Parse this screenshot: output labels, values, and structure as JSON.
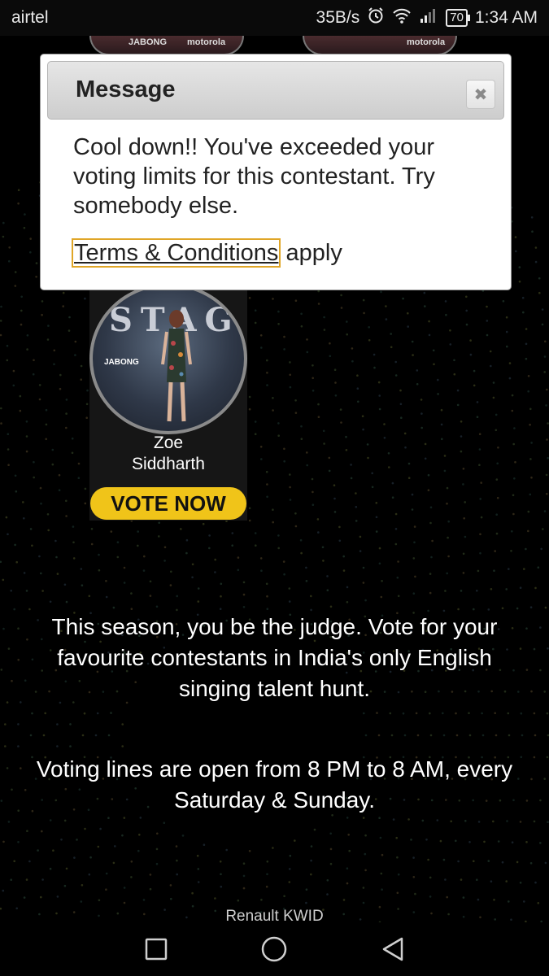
{
  "status_bar": {
    "carrier": "airtel",
    "speed": "35B/s",
    "battery": "70",
    "time": "1:34 AM"
  },
  "peek_cards": {
    "left_brand": "JABONG",
    "left_sponsor": "motorola",
    "right_sponsor": "motorola"
  },
  "modal": {
    "title": "Message",
    "message": "Cool down!! You've exceeded your voting limits for this contestant. Try somebody else.",
    "terms_link": "Terms & Conditions",
    "terms_suffix": " apply"
  },
  "contestant": {
    "photo_text": "STAGE",
    "photo_brand": "JABONG",
    "name_line1": "Zoe",
    "name_line2": "Siddharth",
    "vote_label": "VOTE NOW"
  },
  "description": {
    "paragraph1": "This season, you be the judge. Vote for your favourite contestants in India's only English singing talent hunt.",
    "paragraph2": "Voting lines are open from 8 PM to 8 AM, every Saturday & Sunday."
  },
  "sponsor": "Renault KWID",
  "colors": {
    "accent": "#f0c419",
    "background": "#000000",
    "terms_outline": "#e0a627"
  },
  "icons": {
    "recents": "square",
    "home": "circle",
    "back": "triangle"
  }
}
